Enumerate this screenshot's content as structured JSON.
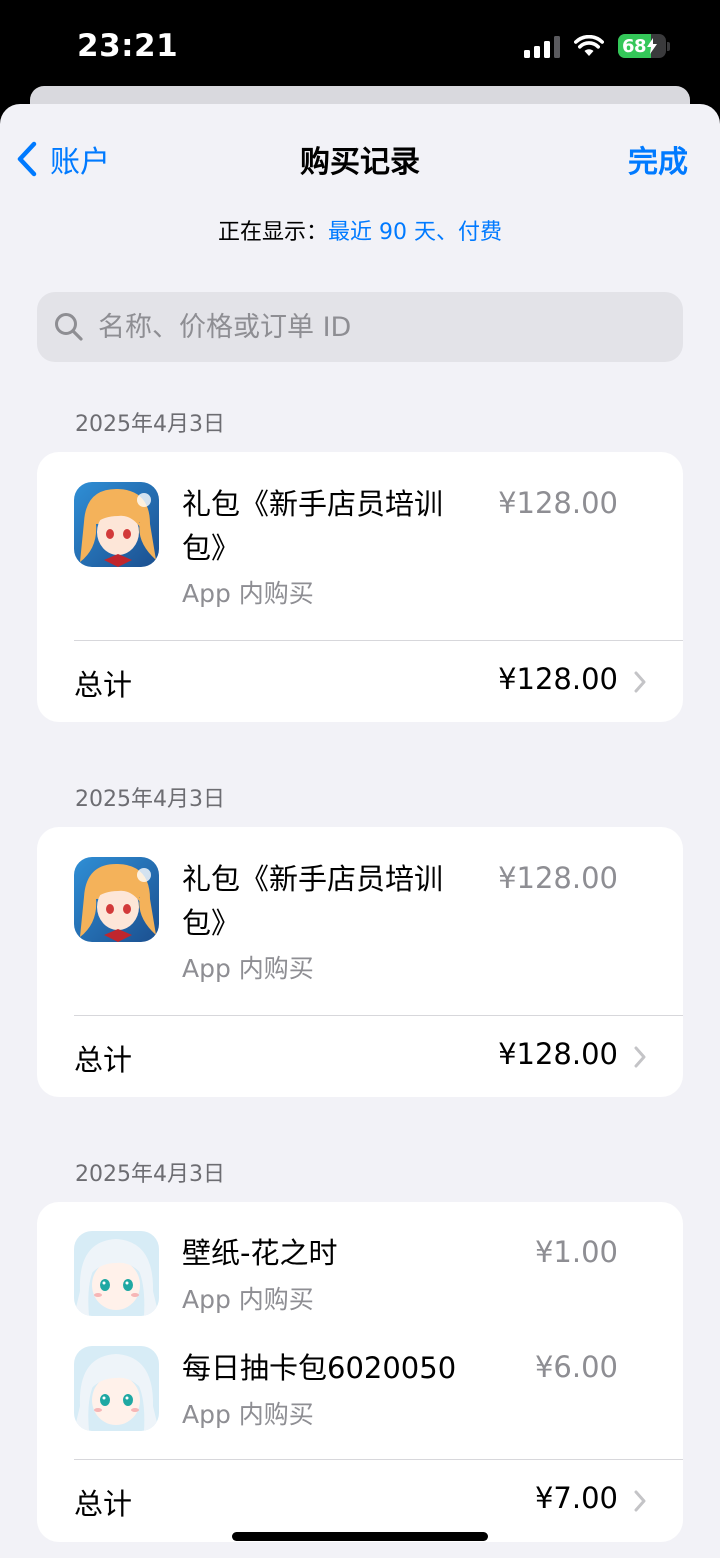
{
  "status": {
    "time": "23:21",
    "battery": "68",
    "battery_fraction": 0.68
  },
  "nav": {
    "back_label": "账户",
    "title": "购买记录",
    "done_label": "完成"
  },
  "filter": {
    "prefix": "正在显示：",
    "value": "最近 90 天、付费"
  },
  "search": {
    "placeholder": "名称、价格或订单 ID"
  },
  "groups": [
    {
      "date": "2025年4月3日",
      "items": [
        {
          "name": "礼包《新手店员培训包》",
          "type": "App 内购买",
          "price": "¥128.00"
        }
      ],
      "total_label": "总计",
      "total": "¥128.00"
    },
    {
      "date": "2025年4月3日",
      "items": [
        {
          "name": "礼包《新手店员培训包》",
          "type": "App 内购买",
          "price": "¥128.00"
        }
      ],
      "total_label": "总计",
      "total": "¥128.00"
    },
    {
      "date": "2025年4月3日",
      "items": [
        {
          "name": "壁纸-花之时",
          "type": "App 内购买",
          "price": "¥1.00"
        },
        {
          "name": "每日抽卡包6020050",
          "type": "App 内购买",
          "price": "¥6.00"
        }
      ],
      "total_label": "总计",
      "total": "¥7.00"
    }
  ],
  "colors": {
    "accent": "#007aff",
    "background": "#f2f2f7",
    "battery": "#34c759"
  }
}
